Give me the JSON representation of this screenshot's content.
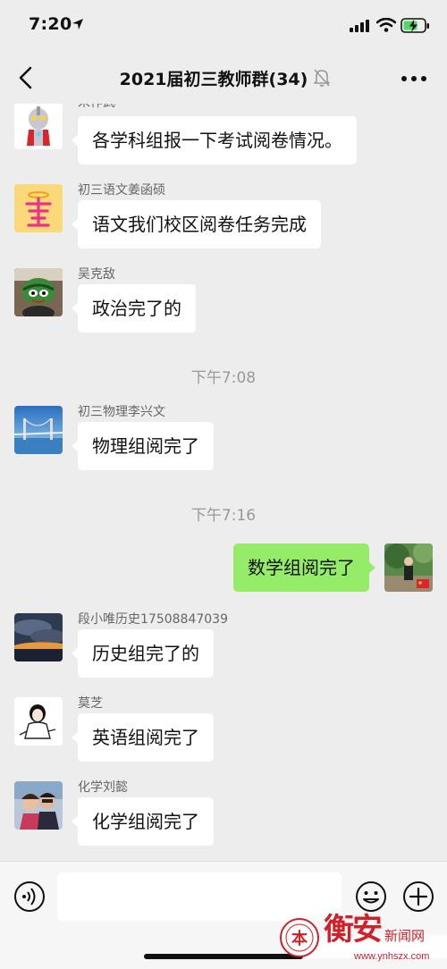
{
  "status_bar": {
    "time": "7:20",
    "icons": [
      "location-arrow-icon",
      "cellular-signal-icon",
      "wifi-icon",
      "battery-charging-icon"
    ]
  },
  "nav": {
    "title": "2021届初三教师群(34)",
    "icons": [
      "back-chevron-icon",
      "mute-bell-icon",
      "more-dots-icon"
    ]
  },
  "messages": [
    {
      "sender": "宋作武",
      "text": "各学科组报一下考试阅卷情况。",
      "avatar": "ultraman-avatar"
    },
    {
      "sender": "初三语文姜函硕",
      "text": "语文我们校区阅卷任务完成",
      "avatar": "jiang-character-avatar"
    },
    {
      "sender": "吴克敌",
      "text": "政治完了的",
      "avatar": "cartoon-turtle-avatar"
    },
    {
      "time": "下午7:08"
    },
    {
      "sender": "初三物理李兴文",
      "text": "物理组阅完了",
      "avatar": "bridge-photo-avatar"
    },
    {
      "time": "下午7:16"
    },
    {
      "self": true,
      "text": "数学组阅完了",
      "avatar": "outdoor-photo-avatar"
    },
    {
      "sender": "段小唯历史17508847039",
      "text": "历史组完了的",
      "avatar": "cloudy-sky-avatar"
    },
    {
      "sender": "莫芝",
      "text": "英语组阅完了",
      "avatar": "sketch-figure-avatar"
    },
    {
      "sender": "化学刘懿",
      "text": "化学组阅完了",
      "avatar": "couple-photo-avatar"
    }
  ],
  "input_bar": {
    "value": "",
    "icons": [
      "voice-icon",
      "emoji-icon",
      "plus-icon"
    ]
  },
  "watermark": {
    "brand": "衡安",
    "site": "新闻网",
    "url": "www.ynhszx.com",
    "seal_text": "本"
  },
  "colors": {
    "background": "#ededed",
    "self_bubble": "#95ec69",
    "other_bubble": "#ffffff",
    "watermark": "#d0202a"
  }
}
